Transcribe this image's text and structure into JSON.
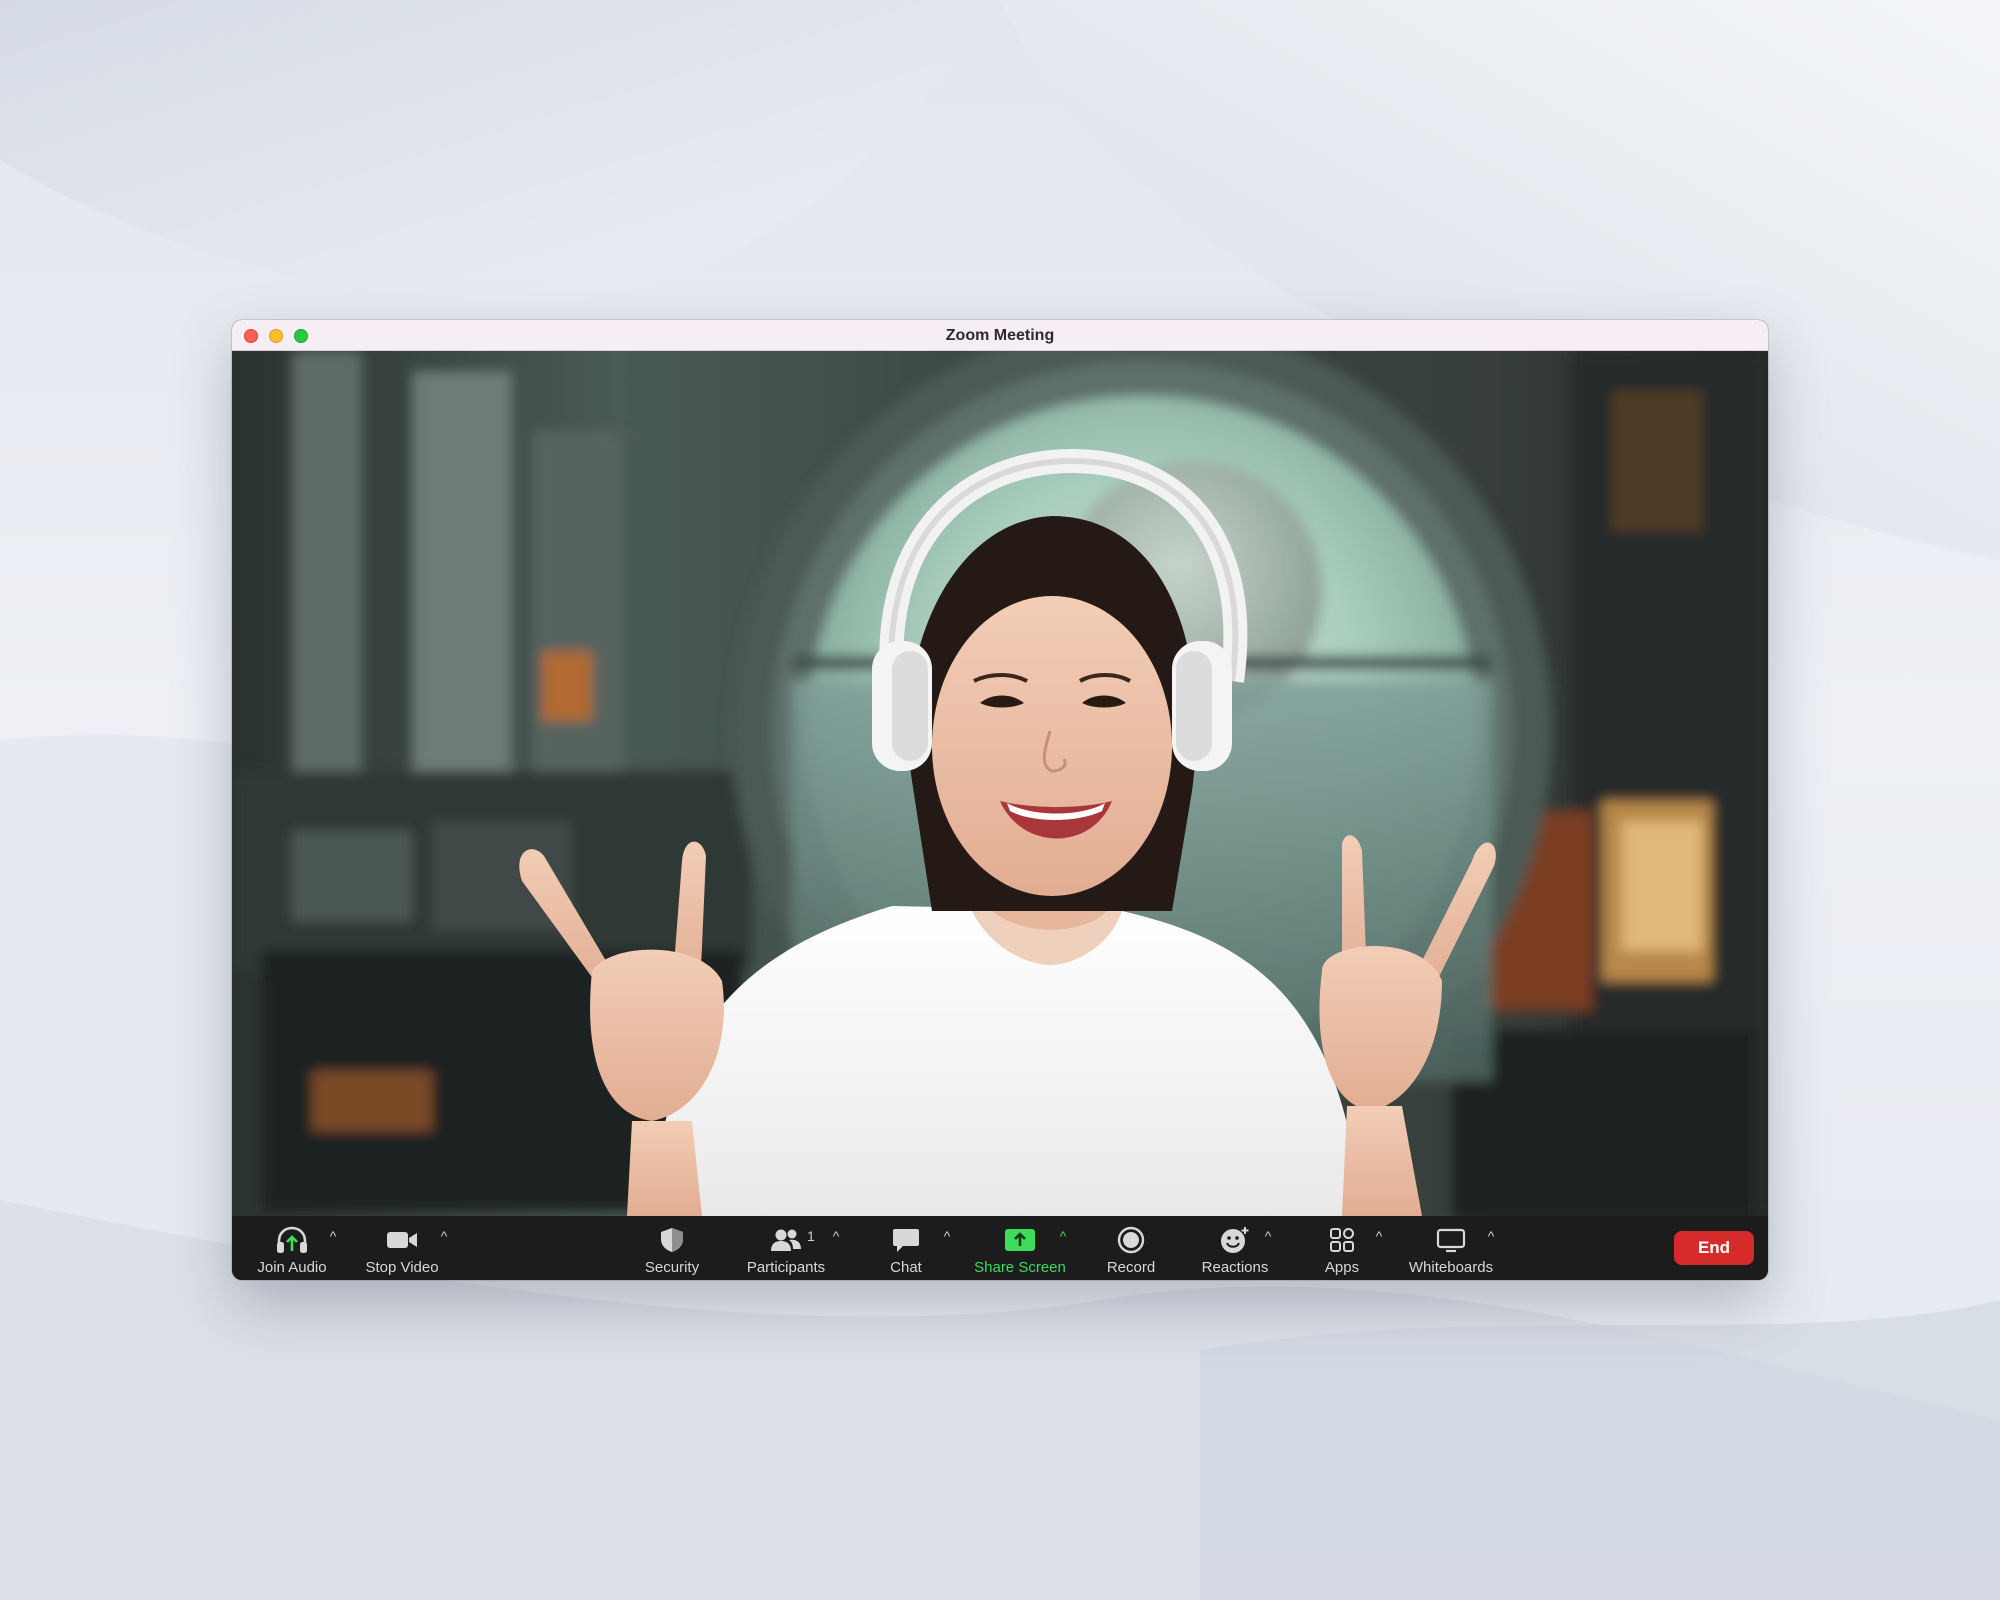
{
  "window": {
    "title": "Zoom Meeting"
  },
  "toolbar": {
    "join_audio": "Join Audio",
    "stop_video": "Stop Video",
    "security": "Security",
    "participants": "Participants",
    "participants_count": "1",
    "chat": "Chat",
    "share_screen": "Share Screen",
    "record": "Record",
    "reactions": "Reactions",
    "apps": "Apps",
    "whiteboards": "Whiteboards",
    "end": "End"
  },
  "icons": {
    "join_audio": "headphones-icon",
    "stop_video": "video-camera-icon",
    "security": "shield-icon",
    "participants": "people-icon",
    "chat": "chat-bubble-icon",
    "share_screen": "share-screen-icon",
    "record": "record-icon",
    "reactions": "smiley-icon",
    "apps": "apps-icon",
    "whiteboards": "whiteboard-icon",
    "options": "chevron-up-icon"
  },
  "colors": {
    "accent_green": "#3ddc5c",
    "end_red": "#d52b2b",
    "toolbar_bg": "#1c1c1c",
    "titlebar_bg": "#f6eef4"
  }
}
